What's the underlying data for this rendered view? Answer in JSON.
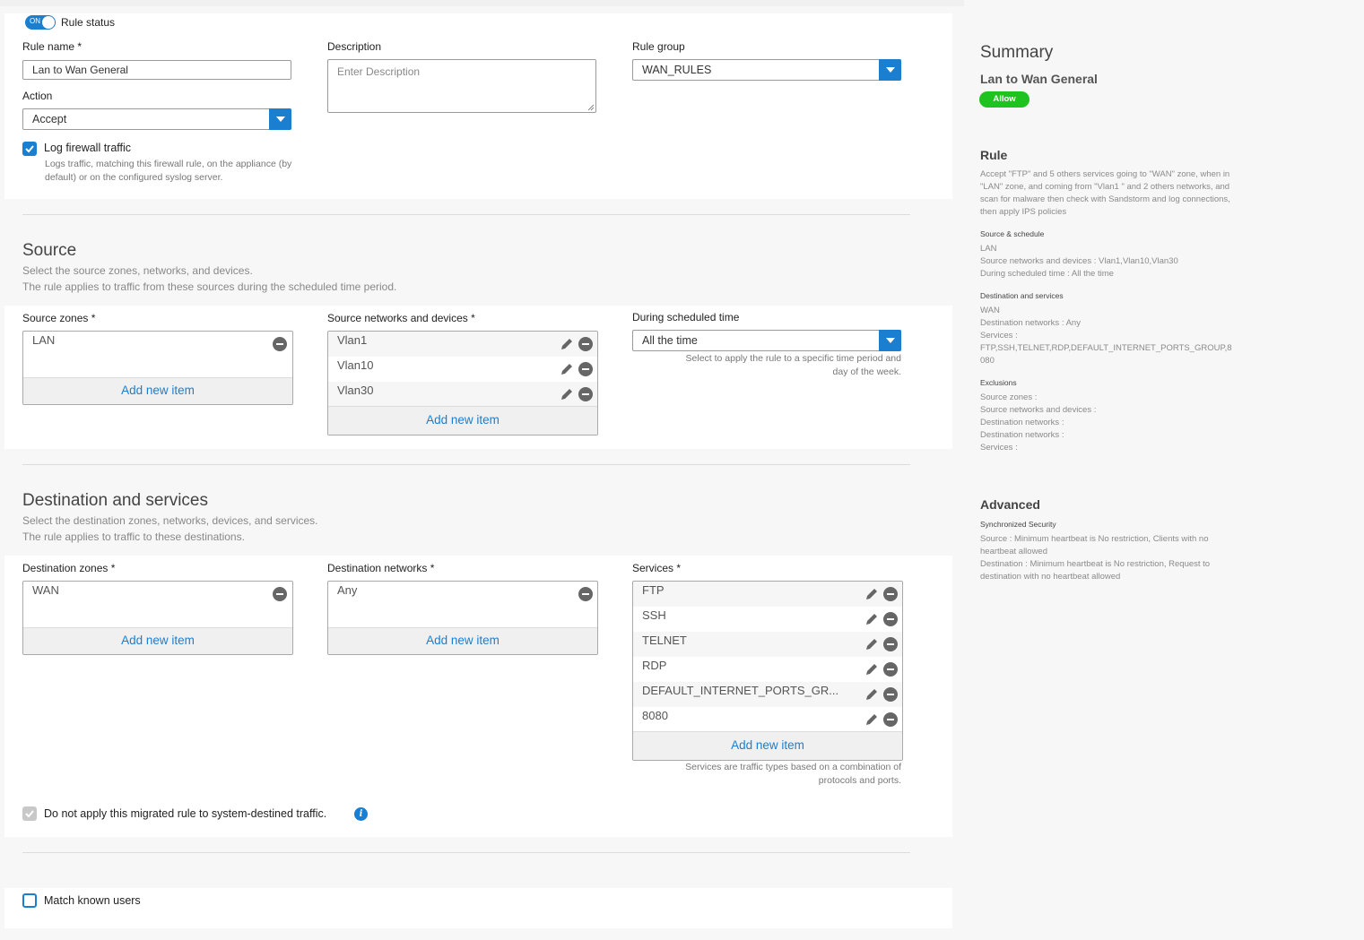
{
  "rule_status": {
    "toggle_text": "ON",
    "label": "Rule status"
  },
  "rule_name": {
    "label": "Rule name *",
    "value": "Lan to Wan General"
  },
  "description": {
    "label": "Description",
    "placeholder": "Enter Description"
  },
  "rule_group": {
    "label": "Rule group",
    "value": "WAN_RULES"
  },
  "action": {
    "label": "Action",
    "value": "Accept"
  },
  "log_traffic": {
    "label": "Log firewall traffic",
    "help_1": "Logs traffic, matching this firewall rule, on the appliance (by",
    "help_2": "default) or on the configured syslog server."
  },
  "source": {
    "title": "Source",
    "sub_1": "Select the source zones, networks, and devices.",
    "sub_2": "The rule applies to traffic from these sources during the scheduled time period.",
    "zones_label": "Source zones *",
    "zones": [
      "LAN"
    ],
    "networks_label": "Source networks and devices *",
    "networks": [
      "Vlan1",
      "Vlan10",
      "Vlan30"
    ],
    "schedule_label": "During scheduled time",
    "schedule_value": "All the time",
    "schedule_help_1": "Select to apply the rule to a specific time period and",
    "schedule_help_2": "day of the week.",
    "add_item": "Add new item"
  },
  "destination": {
    "title": "Destination and services",
    "sub_1": "Select the destination zones, networks, devices, and services.",
    "sub_2": "The rule applies to traffic to these destinations.",
    "zones_label": "Destination zones *",
    "zones": [
      "WAN"
    ],
    "networks_label": "Destination networks *",
    "networks": [
      "Any"
    ],
    "services_label": "Services *",
    "services": [
      "FTP",
      "SSH",
      "TELNET",
      "RDP",
      "DEFAULT_INTERNET_PORTS_GR...",
      "8080"
    ],
    "services_help_1": "Services are traffic types based on a combination of",
    "services_help_2": "protocols and ports.",
    "add_item": "Add new item"
  },
  "migrated": {
    "label": "Do not apply this migrated rule to system-destined traffic.",
    "info": "i"
  },
  "match_users": {
    "label": "Match known users"
  },
  "summary": {
    "title": "Summary",
    "name": "Lan to Wan General",
    "badge": "Allow",
    "rule_heading": "Rule",
    "rule_text": "Accept \"FTP\" and 5 others services going to \"WAN\" zone, when in \"LAN\" zone, and coming from \"Vlan1 \" and 2 others networks, and scan for malware then check with Sandstorm and log connections, then apply IPS policies",
    "source_heading": "Source & schedule",
    "source_lines": [
      "LAN",
      "Source networks and devices : Vlan1,Vlan10,Vlan30",
      "During scheduled time : All the time"
    ],
    "dest_heading": "Destination and services",
    "dest_lines": [
      "WAN",
      "Destination networks : Any",
      "Services :",
      "FTP,SSH,TELNET,RDP,DEFAULT_INTERNET_PORTS_GROUP,8",
      "080"
    ],
    "excl_heading": "Exclusions",
    "excl_lines": [
      "Source zones :",
      "Source networks and devices :",
      "Destination networks :",
      "Destination networks :",
      "Services :"
    ],
    "advanced_heading": "Advanced",
    "sync_heading": "Synchronized Security",
    "sync_lines": [
      "Source : Minimum heartbeat is No restriction, Clients with no",
      "heartbeat allowed",
      "Destination : Minimum heartbeat is No restriction, Request to",
      "destination with no heartbeat allowed"
    ]
  },
  "colors": {
    "accent": "#1a7ed1",
    "allow_badge": "#1fc31f"
  }
}
